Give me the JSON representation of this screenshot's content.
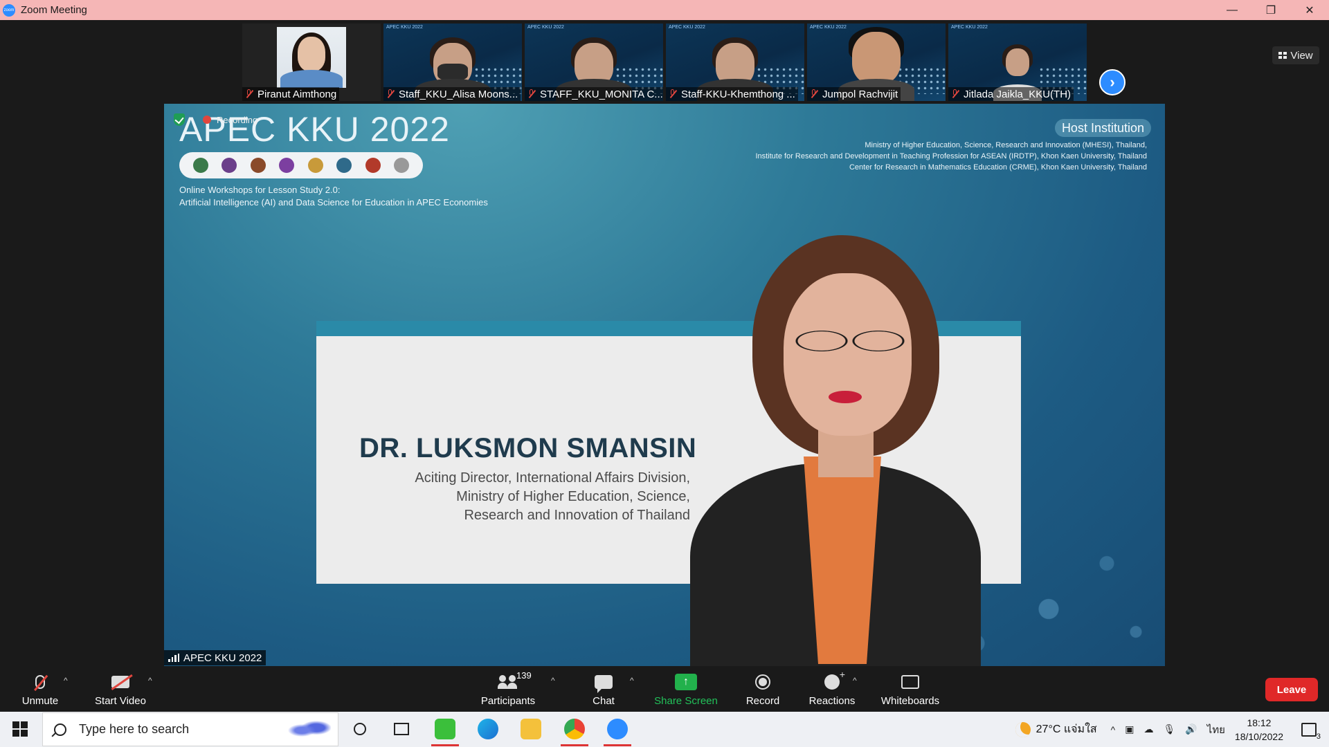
{
  "window": {
    "title": "Zoom Meeting",
    "app_icon_text": "zoom",
    "controls": [
      "—",
      "❐",
      "✕"
    ]
  },
  "gallery": {
    "participants": [
      {
        "name": "Piranut Aimthong"
      },
      {
        "name": "Staff_KKU_Alisa Moons..."
      },
      {
        "name": "STAFF_KKU_MONITA C..."
      },
      {
        "name": "Staff-KKU-Khemthong ..."
      },
      {
        "name": "Jumpol Rachvijit"
      },
      {
        "name": "Jitlada Jaikla_KKU(TH)"
      }
    ],
    "thumb_slide_title": "APEC KKU 2022",
    "next_icon": "chevron-right-icon",
    "view_label": "View"
  },
  "share": {
    "recording_label": "Recording",
    "slide_title": "APEC KKU 2022",
    "subtitle_line1": "Online Workshops for Lesson Study 2.0:",
    "subtitle_line2": "Artificial Intelligence (AI) and Data Science for Education in APEC Economies",
    "host_badge": "Host Institution",
    "host_line1": "Ministry of Higher Education, Science, Research and Innovation (MHESI), Thailand,",
    "host_line2": "Institute for Research and Development in Teaching Profession for ASEAN (IRDTP), Khon Kaen University, Thailand",
    "host_line3": "Center for Research in Mathematics Education (CRME), Khon Kaen University, Thailand",
    "speaker_name": "DR. LUKSMON SMANSIN",
    "speaker_role_line1": "Aciting Director, International Affairs Division,",
    "speaker_role_line2": "Ministry of Higher Education, Science,",
    "speaker_role_line3": "Research and Innovation of Thailand",
    "share_label": "APEC KKU 2022"
  },
  "controls": {
    "unmute": "Unmute",
    "start_video": "Start Video",
    "participants": "Participants",
    "participants_count": "139",
    "chat": "Chat",
    "share_screen": "Share Screen",
    "record": "Record",
    "reactions": "Reactions",
    "whiteboards": "Whiteboards",
    "leave": "Leave",
    "caret": "^",
    "share_arrow": "↑"
  },
  "taskbar": {
    "search_placeholder": "Type here to search",
    "weather": "27°C แจ่มใส",
    "language": "ไทย",
    "time": "18:12",
    "date": "18/10/2022",
    "notifications_count": "3",
    "tray_symbols": [
      "^",
      "▣",
      "☁",
      "🎙",
      "🔊"
    ]
  },
  "colors": {
    "accent": "#2d8cff",
    "leave": "#e02828",
    "share_green": "#22b14c",
    "titlebar": "#f5b6b6"
  }
}
